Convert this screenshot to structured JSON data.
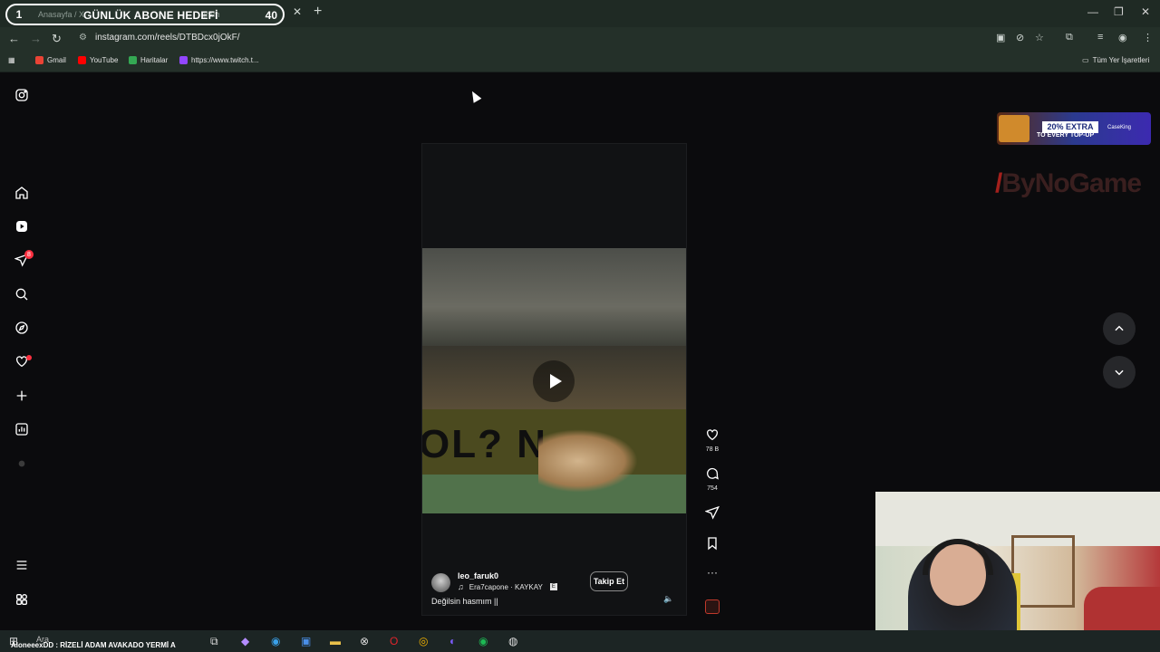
{
  "browser": {
    "tab_number": "1",
    "tab_ghost_title": "Anasayfa / X",
    "tab_ghost_title2": "gram",
    "stream_goal_label": "GÜNLÜK ABONE HEDEFİ",
    "stream_goal_count": "40",
    "url": "instagram.com/reels/DTBDcx0jOkF/",
    "bookmarks": [
      {
        "label": "Gmail",
        "color": "#ea4335"
      },
      {
        "label": "YouTube",
        "color": "#ff0000"
      },
      {
        "label": "Haritalar",
        "color": "#34a853"
      },
      {
        "label": "https://www.twitch.t...",
        "color": "#9146ff"
      }
    ],
    "all_bookmarks": "Tüm Yer İşaretleri"
  },
  "sidebar": {
    "notification_badge": "8",
    "items": [
      "instagram-logo",
      "home",
      "reels",
      "messages",
      "search",
      "explore",
      "notifications",
      "create",
      "dashboard",
      "profile",
      "more",
      "also-from-meta"
    ]
  },
  "reel": {
    "video_board_text": "OL?  N",
    "username": "leo_faruk0",
    "audio": "Era7capone · KAYKAY",
    "explicit_badge": "E",
    "follow_label": "Takip Et",
    "caption": "Değilsin hasmım ||",
    "likes": "78 B",
    "comments": "754"
  },
  "ads": {
    "extra": "20% EXTRA",
    "topup": "TO EVERY TOP-UP",
    "casebutton": "CaseKing",
    "bynogame": "ByNoGame"
  },
  "taskbar": {
    "ticker": "AloneeexDD : RİZELİ ADAM AVAKADO YERMİ A",
    "search_placeholder": "Ara"
  },
  "colors": {
    "badge": "#ff3040",
    "background": "#0b0b0d",
    "browser_chrome": "#243029"
  }
}
